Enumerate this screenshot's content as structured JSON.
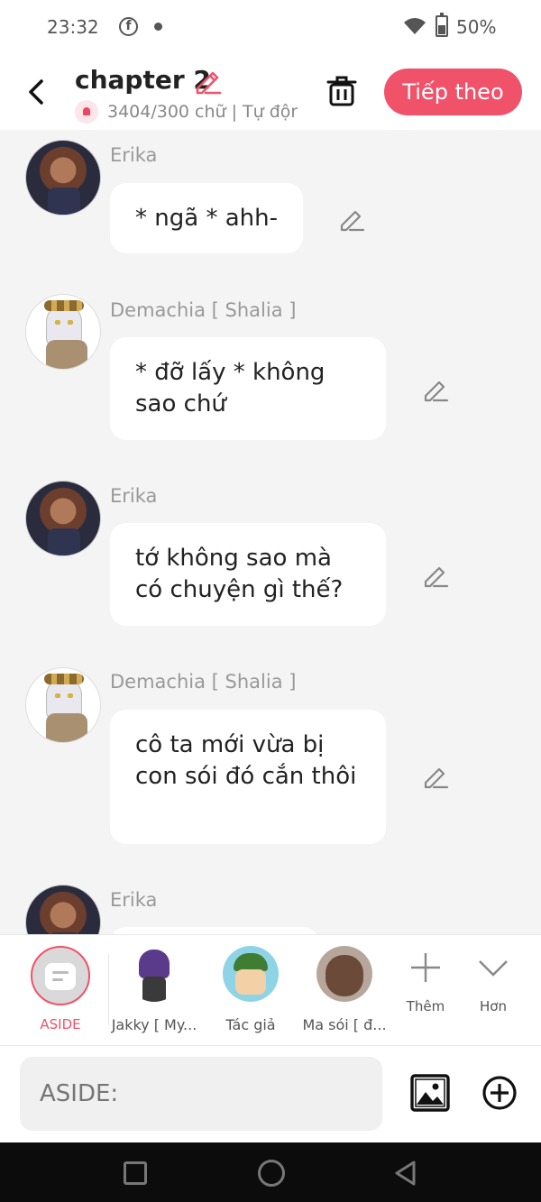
{
  "status": {
    "time": "23:32",
    "battery": "50%"
  },
  "header": {
    "title": "chapter 2",
    "word_count": "3404/300 chữ",
    "separator": "|",
    "autosave": "Tự động lưu",
    "next_label": "Tiếp theo"
  },
  "messages": [
    {
      "name": "Erika",
      "text": "* ngã * ahh-",
      "avatar": "erika"
    },
    {
      "name": "Demachia [ Shalia ]",
      "text": "* đỡ lấy * không sao chứ",
      "avatar": "demachia"
    },
    {
      "name": "Erika",
      "text": "tớ không sao mà có chuyện gì thế?",
      "avatar": "erika"
    },
    {
      "name": "Demachia [ Shalia ]",
      "text": "cô ta mới vừa bị con sói đó cắn thôi",
      "avatar": "demachia"
    },
    {
      "name": "Erika",
      "text": "",
      "avatar": "erika"
    }
  ],
  "characters": {
    "aside_label": "ASIDE",
    "items": [
      {
        "label": "Jakky [ My..."
      },
      {
        "label": "Tác giả"
      },
      {
        "label": "Ma sói [ đ..."
      }
    ],
    "add_label": "Thêm",
    "more_label": "Hơn"
  },
  "composer": {
    "placeholder": "ASIDE:"
  },
  "icons": {
    "back": "back-arrow-icon",
    "edit": "pencil-icon",
    "trash": "trash-icon",
    "image": "image-icon",
    "add": "add-circle-icon"
  },
  "colors": {
    "accent": "#f0526a",
    "background": "#f4f4f4",
    "bubble": "#ffffff"
  }
}
